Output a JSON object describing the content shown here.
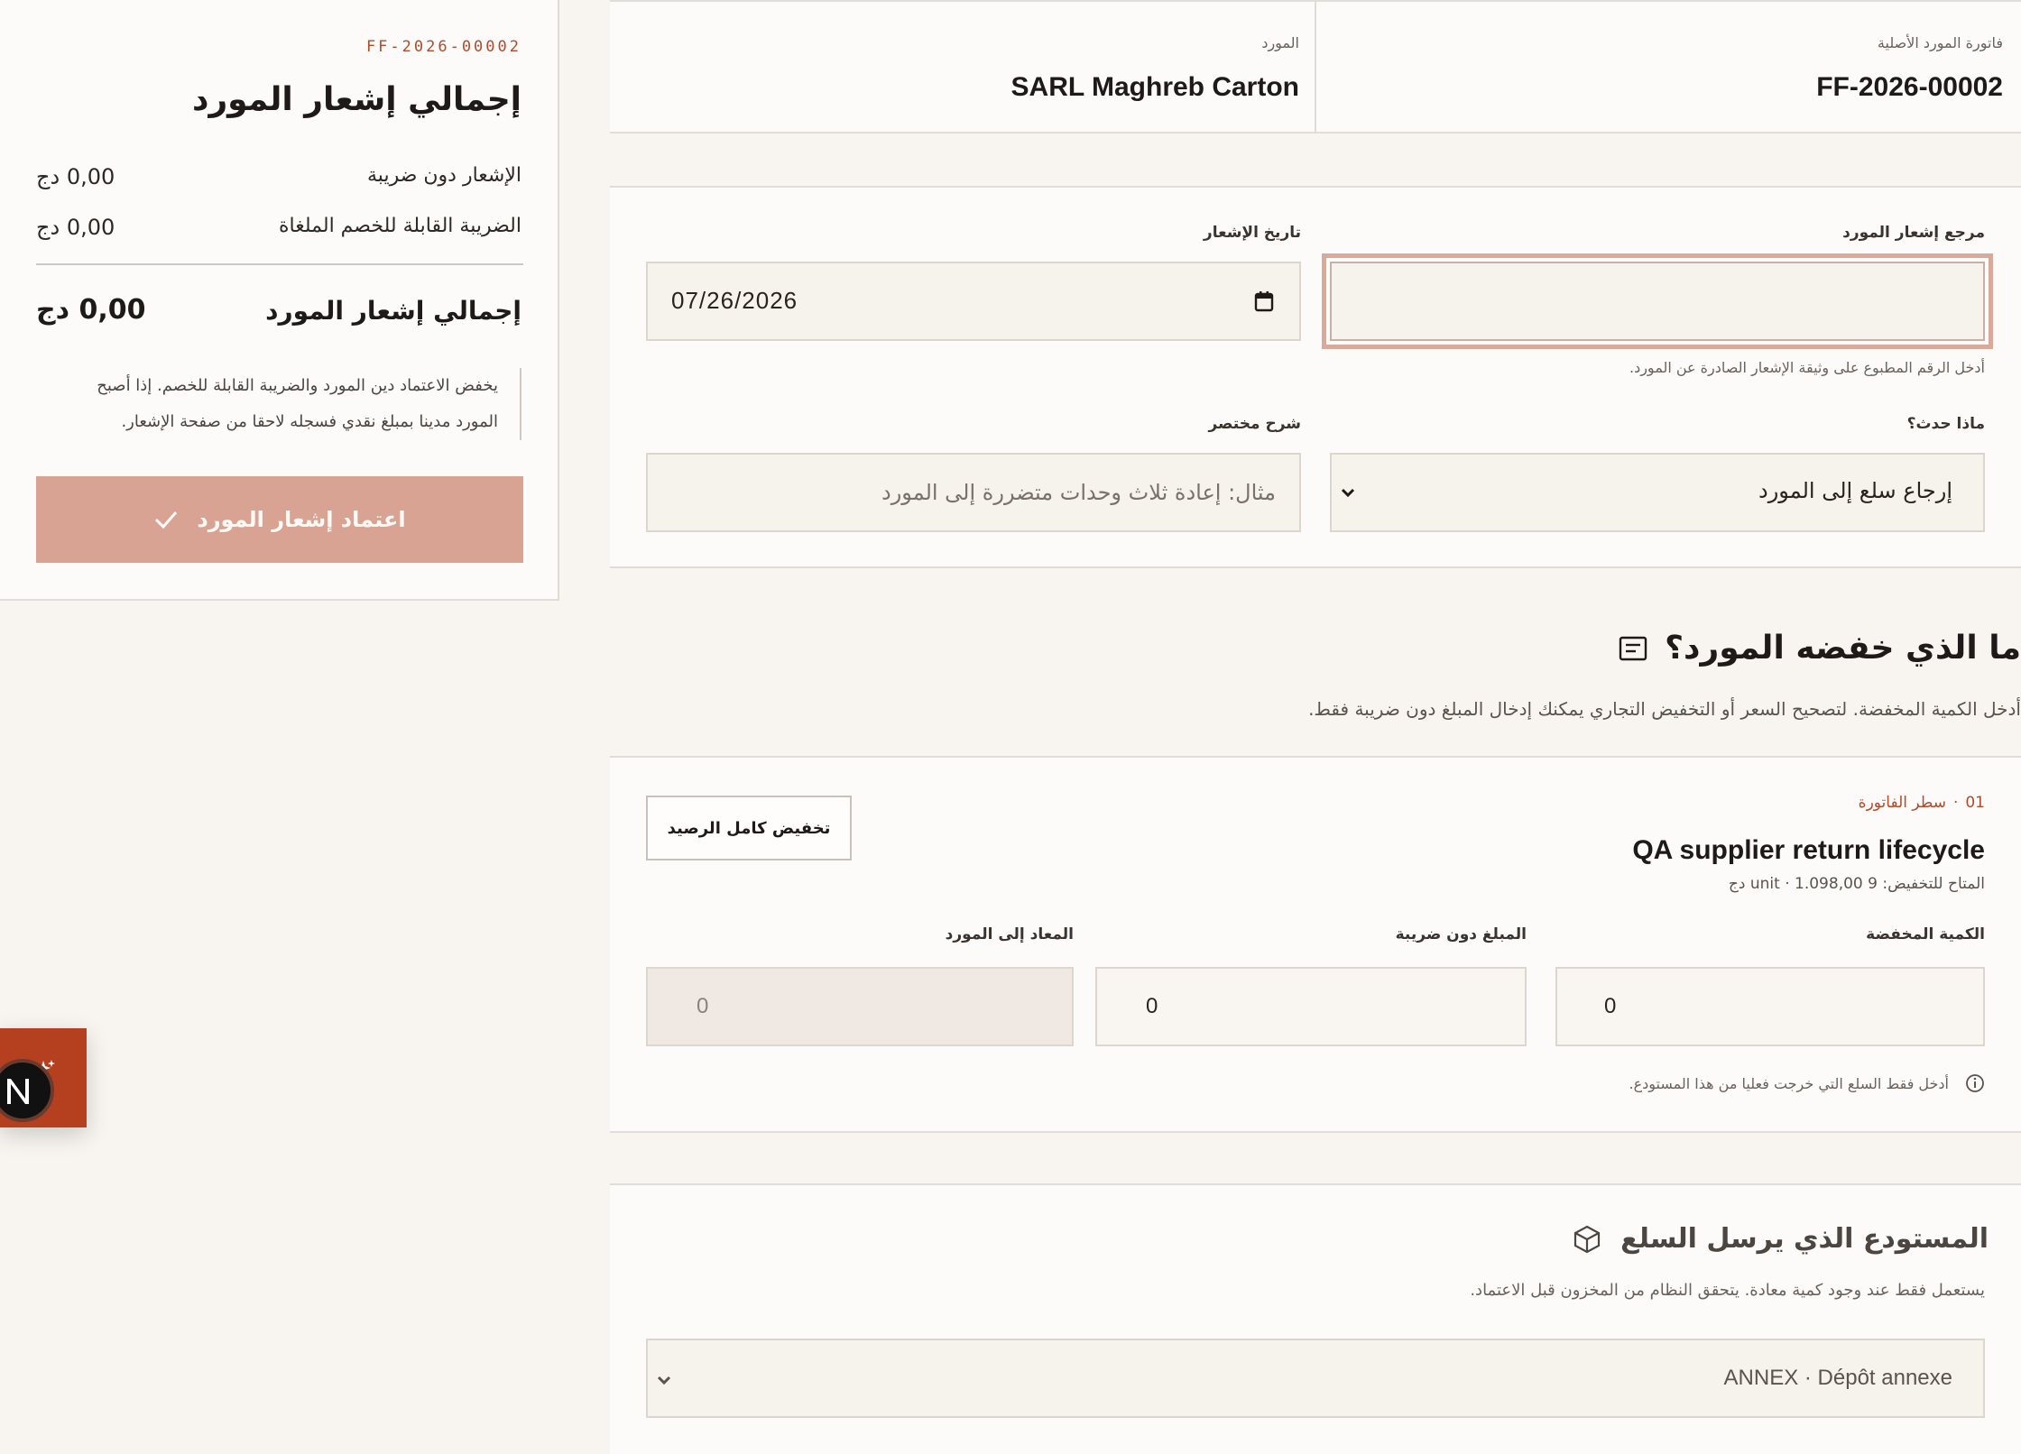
{
  "invoice": {
    "original_label": "فاتورة المورد الأصلية",
    "original_value": "FF-2026-00002",
    "supplier_label": "المورد",
    "supplier_value": "SARL Maghreb Carton"
  },
  "form": {
    "ref_label": "مرجع إشعار المورد",
    "ref_value": "",
    "ref_help": "أدخل الرقم المطبوع على وثيقة الإشعار الصادرة عن المورد.",
    "date_label": "تاريخ الإشعار",
    "date_value": "07/26/2026",
    "what_label": "ماذا حدث؟",
    "what_value": "إرجاع سلع إلى المورد",
    "desc_label": "شرح مختصر",
    "desc_placeholder": "مثال: إعادة ثلاث وحدات متضررة إلى المورد"
  },
  "reduce_section": {
    "title": "ما الذي خفضه المورد؟",
    "subtitle": "أدخل الكمية المخفضة. لتصحيح السعر أو التخفيض التجاري يمكنك إدخال المبلغ دون ضريبة فقط."
  },
  "line": {
    "number": "01",
    "kind": "سطر الفاتورة",
    "full_button": "تخفيض كامل الرصيد",
    "title": "QA supplier return lifecycle",
    "available": "المتاح للتخفيض: 9 unit · 1.098,00 دج",
    "qty_label": "الكمية المخفضة",
    "qty_value": "0",
    "amount_label": "المبلغ دون ضريبة",
    "amount_value": "0",
    "returned_label": "المعاد إلى المورد",
    "returned_value": "0",
    "note": "أدخل فقط السلع التي خرجت فعليا من هذا المستودع."
  },
  "warehouse": {
    "title": "المستودع الذي يرسل السلع",
    "subtitle": "يستعمل فقط عند وجود كمية معادة. يتحقق النظام من المخزون قبل الاعتماد.",
    "selected": "ANNEX · Dépôt annexe"
  },
  "summary": {
    "ref": "FF-2026-00002",
    "title": "إجمالي إشعار المورد",
    "rows": [
      {
        "label": "الإشعار دون ضريبة",
        "value": "0,00 دج"
      },
      {
        "label": "الضريبة القابلة للخصم الملغاة",
        "value": "0,00 دج"
      }
    ],
    "total_label": "إجمالي إشعار المورد",
    "total_value": "0,00 دج",
    "note_line1": "يخفض الاعتماد دين المورد والضريبة القابلة للخصم. إذا أصبح",
    "note_line2": "المورد مدينا بمبلغ نقدي فسجله لاحقا من صفحة الإشعار.",
    "confirm_button": "اعتماد إشعار المورد"
  },
  "colors": {
    "accent": "#b34a2a",
    "primary_button": "#d9a394",
    "background": "#f8f5f0"
  }
}
